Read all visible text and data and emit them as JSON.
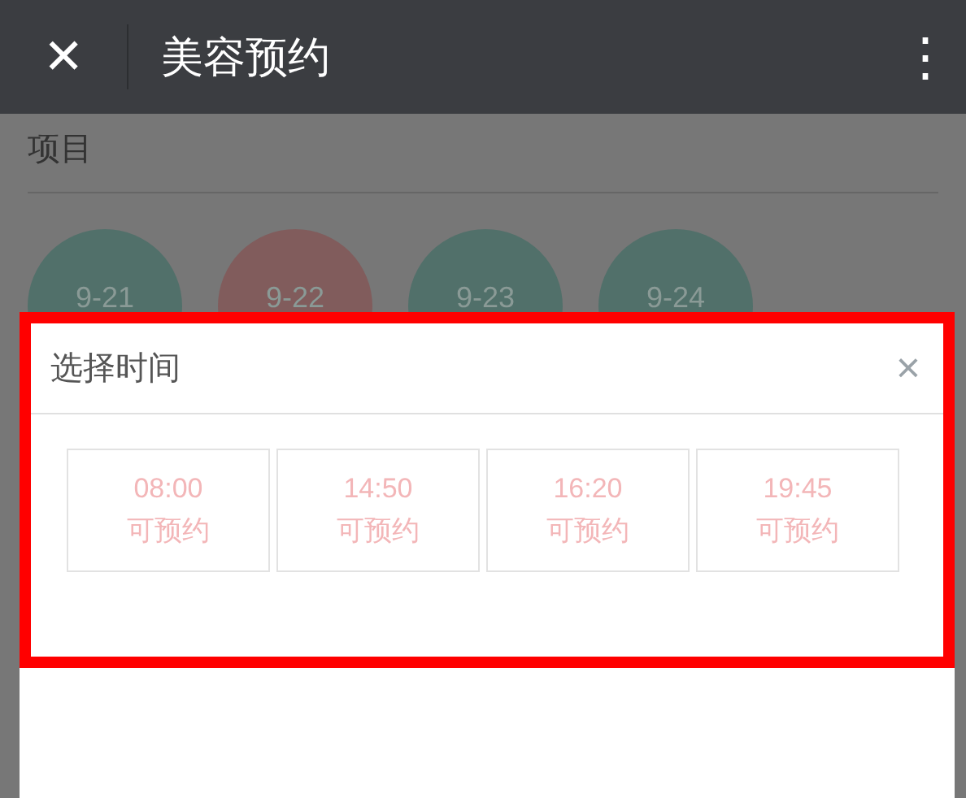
{
  "top_bar": {
    "close_icon": "✕",
    "title": "美容预约",
    "more_icon": "⋮"
  },
  "section": {
    "title": "项目"
  },
  "dates": [
    {
      "label": "9-21",
      "color": "#51706a"
    },
    {
      "label": "9-22",
      "color": "#815c5c"
    },
    {
      "label": "9-23",
      "color": "#51706a"
    },
    {
      "label": "9-24",
      "color": "#51706a"
    }
  ],
  "dialog": {
    "title": "选择时间",
    "close": "×",
    "slots": [
      {
        "time": "08:00",
        "status": "可预约",
        "available": true
      },
      {
        "time": "14:50",
        "status": "可预约",
        "available": true
      },
      {
        "time": "16:20",
        "status": "可预约",
        "available": true
      },
      {
        "time": "19:45",
        "status": "可预约",
        "available": true
      }
    ]
  }
}
